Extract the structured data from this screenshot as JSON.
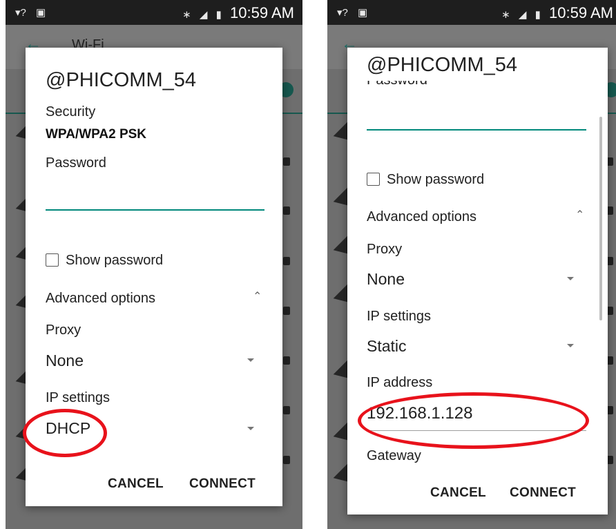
{
  "left": {
    "status_bar": {
      "time": "10:59 AM"
    },
    "app_bar": {
      "title": "Wi-Fi"
    },
    "dialog": {
      "network_name": "@PHICOMM_54",
      "security_label": "Security",
      "security_value": "WPA/WPA2 PSK",
      "password_label": "Password",
      "password_value": "",
      "show_password_label": "Show password",
      "show_password_checked": false,
      "advanced_label": "Advanced options",
      "proxy_label": "Proxy",
      "proxy_value": "None",
      "ip_settings_label": "IP settings",
      "ip_settings_value": "DHCP",
      "cancel_label": "CANCEL",
      "connect_label": "CONNECT"
    }
  },
  "right": {
    "status_bar": {
      "time": "10:59 AM"
    },
    "dialog": {
      "network_name": "@PHICOMM_54",
      "password_label_partial": "Password",
      "password_value": "",
      "show_password_label": "Show password",
      "show_password_checked": false,
      "advanced_label": "Advanced options",
      "proxy_label": "Proxy",
      "proxy_value": "None",
      "ip_settings_label": "IP settings",
      "ip_settings_value": "Static",
      "ip_address_label": "IP address",
      "ip_address_value": "192.168.1.128",
      "gateway_label": "Gateway",
      "cancel_label": "CANCEL",
      "connect_label": "CONNECT"
    }
  },
  "colors": {
    "accent": "#00897b",
    "highlight_circle": "#e8121b",
    "status_bar": "#1e1e1e",
    "scrim": "#6e6e6e"
  },
  "icons": [
    "wifi-question-icon",
    "image-icon",
    "bluetooth-icon",
    "no-sim-icon",
    "battery-charging-icon",
    "back-arrow-icon",
    "checkbox-icon",
    "chevron-up-icon",
    "dropdown-caret-icon",
    "wifi-signal-icon",
    "lock-icon"
  ]
}
